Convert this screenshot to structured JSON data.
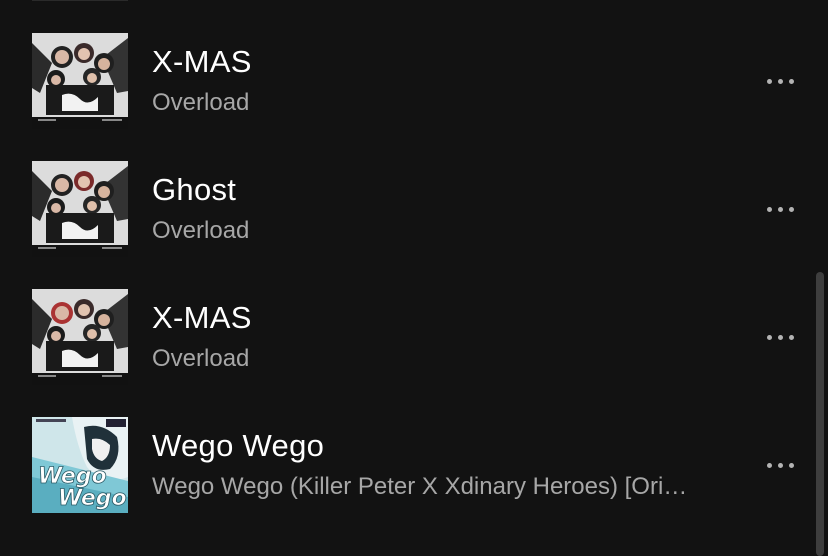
{
  "tracks": [
    {
      "title": "X-MAS",
      "subtitle": "Overload",
      "cover_icon": "overload-album-cover",
      "more_label": "More options"
    },
    {
      "title": "Ghost",
      "subtitle": "Overload",
      "cover_icon": "overload-album-cover",
      "more_label": "More options"
    },
    {
      "title": "X-MAS",
      "subtitle": "Overload",
      "cover_icon": "overload-album-cover",
      "more_label": "More options"
    },
    {
      "title": "Wego Wego",
      "subtitle": "Wego Wego (Killer Peter X Xdinary Heroes) [Ori…",
      "cover_icon": "wego-wego-album-cover",
      "more_label": "More options"
    }
  ],
  "colors": {
    "background": "#121212",
    "title": "#ffffff",
    "subtitle": "#a7a7a7",
    "icon": "#b3b3b3"
  }
}
